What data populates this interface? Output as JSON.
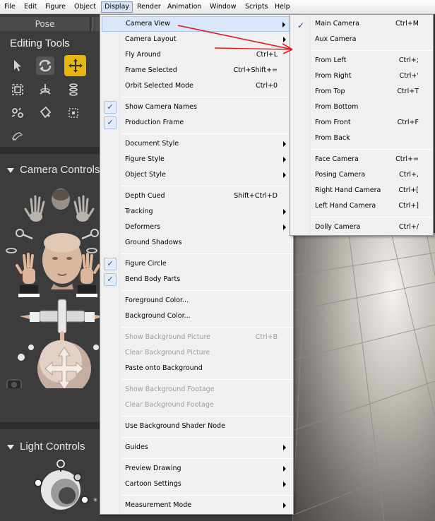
{
  "menubar": {
    "items": [
      "File",
      "Edit",
      "Figure",
      "Object",
      "Display",
      "Render",
      "Animation",
      "Window",
      "Scripts",
      "Help"
    ],
    "open_item": "Display"
  },
  "left_panel": {
    "tab": "Pose",
    "editing_tools_title": "Editing Tools",
    "camera_controls_title": "Camera Controls",
    "light_controls_title": "Light Controls"
  },
  "display_menu": {
    "items": [
      {
        "label": "Camera View",
        "shortcut": "",
        "submenu": true,
        "checked": false,
        "disabled": false,
        "selected": true
      },
      {
        "label": "Camera Layout",
        "shortcut": "",
        "submenu": true
      },
      {
        "label": "Fly Around",
        "shortcut": "Ctrl+L"
      },
      {
        "label": "Frame Selected",
        "shortcut": "Ctrl+Shift+="
      },
      {
        "label": "Orbit Selected Mode",
        "shortcut": "Ctrl+0"
      },
      {
        "label": "Show Camera Names",
        "shortcut": "",
        "checked": true
      },
      {
        "label": "Production Frame",
        "shortcut": "",
        "checked": true
      },
      {
        "label": "Document Style",
        "shortcut": "",
        "submenu": true
      },
      {
        "label": "Figure Style",
        "shortcut": "",
        "submenu": true
      },
      {
        "label": "Object Style",
        "shortcut": "",
        "submenu": true
      },
      {
        "label": "Depth Cued",
        "shortcut": "Shift+Ctrl+D"
      },
      {
        "label": "Tracking",
        "shortcut": "",
        "submenu": true
      },
      {
        "label": "Deformers",
        "shortcut": "",
        "submenu": true
      },
      {
        "label": "Ground Shadows",
        "shortcut": ""
      },
      {
        "label": "Figure Circle",
        "shortcut": "",
        "checked": true
      },
      {
        "label": "Bend Body Parts",
        "shortcut": "",
        "checked": true
      },
      {
        "label": "Foreground Color...",
        "shortcut": ""
      },
      {
        "label": "Background Color...",
        "shortcut": ""
      },
      {
        "label": "Show Background Picture",
        "shortcut": "Ctrl+B",
        "disabled": true
      },
      {
        "label": "Clear Background Picture",
        "shortcut": "",
        "disabled": true
      },
      {
        "label": "Paste onto Background",
        "shortcut": ""
      },
      {
        "label": "Show Background Footage",
        "shortcut": "",
        "disabled": true
      },
      {
        "label": "Clear Background Footage",
        "shortcut": "",
        "disabled": true
      },
      {
        "label": "Use Background Shader Node",
        "shortcut": ""
      },
      {
        "label": "Guides",
        "shortcut": "",
        "submenu": true
      },
      {
        "label": "Preview Drawing",
        "shortcut": "",
        "submenu": true
      },
      {
        "label": "Cartoon Settings",
        "shortcut": "",
        "submenu": true
      },
      {
        "label": "Measurement Mode",
        "shortcut": "",
        "submenu": true
      }
    ]
  },
  "camera_submenu": {
    "items": [
      {
        "label": "Main Camera",
        "shortcut": "Ctrl+M",
        "checked": true
      },
      {
        "label": "Aux Camera",
        "shortcut": ""
      },
      {
        "label": "From Left",
        "shortcut": "Ctrl+;"
      },
      {
        "label": "From Right",
        "shortcut": "Ctrl+'"
      },
      {
        "label": "From Top",
        "shortcut": "Ctrl+T"
      },
      {
        "label": "From Bottom",
        "shortcut": ""
      },
      {
        "label": "From Front",
        "shortcut": "Ctrl+F"
      },
      {
        "label": "From Back",
        "shortcut": ""
      },
      {
        "label": "Face Camera",
        "shortcut": "Ctrl+="
      },
      {
        "label": "Posing Camera",
        "shortcut": "Ctrl+,"
      },
      {
        "label": "Right Hand Camera",
        "shortcut": "Ctrl+["
      },
      {
        "label": "Left Hand Camera",
        "shortcut": "Ctrl+]"
      },
      {
        "label": "Dolly Camera",
        "shortcut": "Ctrl+/"
      }
    ]
  },
  "colors": {
    "annotation_arrow": "#e01b1b",
    "menu_bg": "#f0f0f0",
    "highlight": "#d8e6f7",
    "active_tool": "#e6b60e",
    "panel_bg": "#3c3c3c"
  },
  "icons": [
    "select-arrow-icon",
    "rotate-icon",
    "translate-icon",
    "scale-icon",
    "twist-icon",
    "taper-icon",
    "chain-break-icon",
    "color-icon",
    "grouping-icon",
    "morph-brush-icon"
  ]
}
